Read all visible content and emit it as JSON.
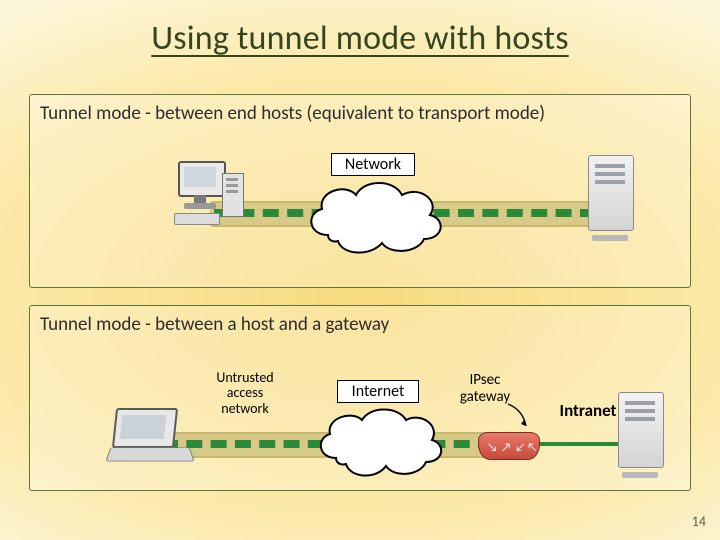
{
  "title": "Using tunnel mode with hosts",
  "panel1": {
    "caption": "Tunnel mode - between end hosts (equivalent to transport mode)",
    "cloud_label": "Network"
  },
  "panel2": {
    "caption": "Tunnel mode - between a host and a gateway",
    "access_label_l1": "Untrusted",
    "access_label_l2": "access",
    "access_label_l3": "network",
    "cloud_label": "Internet",
    "gateway_label_l1": "IPsec",
    "gateway_label_l2": "gateway",
    "intranet_label": "Intranet"
  },
  "page_number": "14"
}
